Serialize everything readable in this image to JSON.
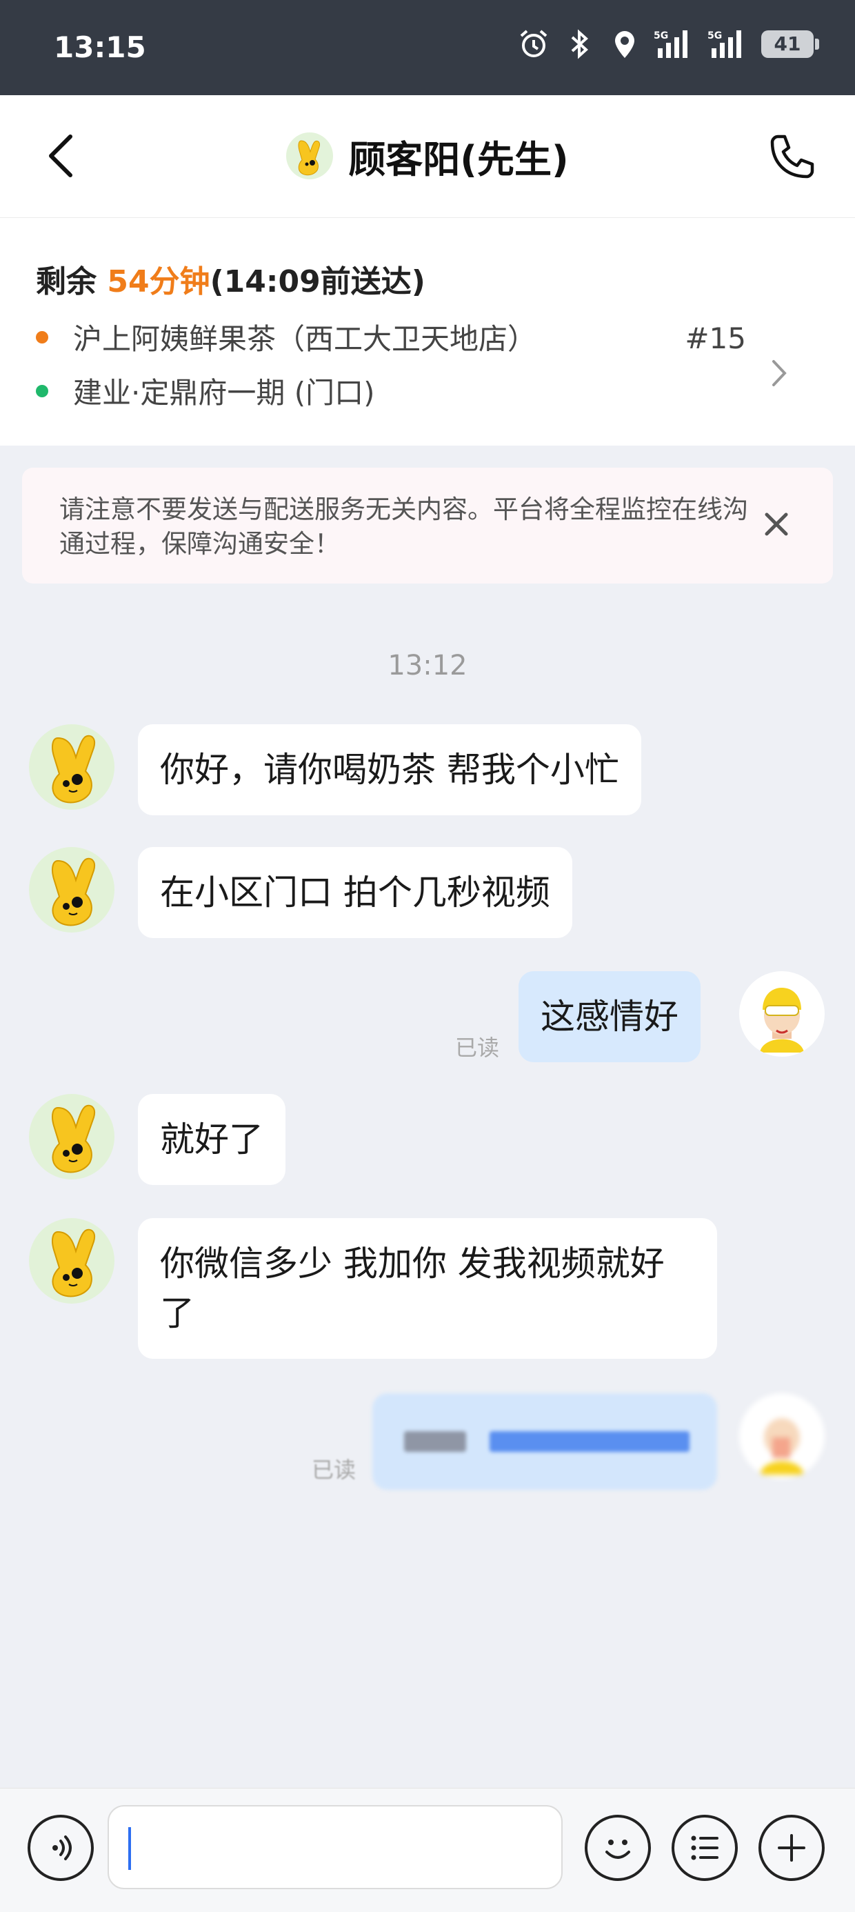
{
  "status_bar": {
    "time": "13:15",
    "battery": "41",
    "icons": [
      "alarm-icon",
      "bluetooth-icon",
      "location-icon",
      "signal-5g-icon",
      "signal-5g-icon",
      "battery-icon"
    ]
  },
  "header": {
    "title": "顾客阳(先生)"
  },
  "order": {
    "remain_prefix": "剩余 ",
    "remain_minutes": "54分钟",
    "remain_suffix": "(14:09前送达)",
    "store": "沪上阿姨鲜果茶（西工大卫天地店）",
    "order_number": "#15",
    "destination": "建业·定鼎府一期 (门口)",
    "store_dot_color": "#f07d1a",
    "dest_dot_color": "#1fb86b"
  },
  "notice": {
    "text": "请注意不要发送与配送服务无关内容。平台将全程监控在线沟通过程，保障沟通安全！"
  },
  "chat": {
    "timestamp": "13:12",
    "messages": [
      {
        "from": "customer",
        "text": "你好，请你喝奶茶 帮我个小忙"
      },
      {
        "from": "customer",
        "text": "在小区门口 拍个几秒视频"
      },
      {
        "from": "me",
        "text": "这感情好",
        "status": "已读"
      },
      {
        "from": "customer",
        "text": "就好了"
      },
      {
        "from": "customer",
        "text": "你微信多少 我加你 发我视频就好了"
      },
      {
        "from": "me",
        "text": "",
        "status": "已读",
        "redacted": true
      }
    ]
  },
  "colors": {
    "accent_orange": "#f07d1a",
    "bubble_me": "#d7e9fd",
    "caret": "#2d6ff2"
  }
}
